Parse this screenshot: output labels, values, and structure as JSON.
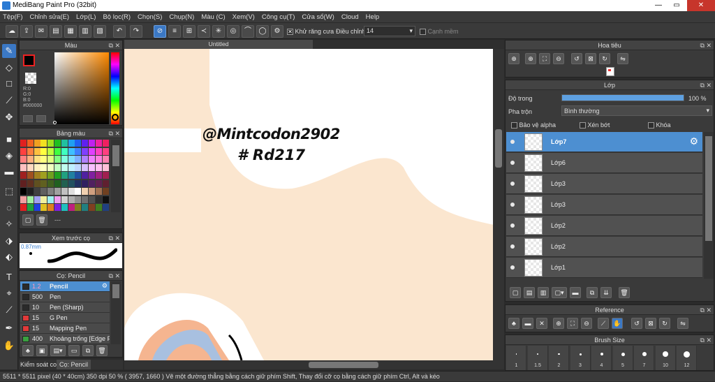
{
  "window": {
    "title": "MediBang Paint Pro (32bit)",
    "minimize": "—",
    "maximize": "▭",
    "close": "✕"
  },
  "menu": [
    "Tệp(F)",
    "Chỉnh sửa(E)",
    "Lớp(L)",
    "Bộ lọc(R)",
    "Chọn(S)",
    "Chụp(N)",
    "Màu (C)",
    "Xem(V)",
    "Công cụ(T)",
    "Cửa sổ(W)",
    "Cloud",
    "Help"
  ],
  "toolbar": {
    "antialias_label": "Khử răng cưa",
    "adjust_label": "Điều chỉnh",
    "adjust_value": "14",
    "edge_label": "Cạnh mềm"
  },
  "color_panel": {
    "title": "Màu",
    "r": "R:0",
    "g": "G:0",
    "b": "B:0",
    "hex": "#000000"
  },
  "palette_panel": {
    "title": "Bảng màu",
    "footer": "---"
  },
  "brush_preview": {
    "title": "Xem trước cọ",
    "size": "0.87mm"
  },
  "brush_panel": {
    "title": "Cọ: Pencil",
    "items": [
      {
        "size": "1.2",
        "name": "Pencil",
        "color": "#2a2a2a"
      },
      {
        "size": "500",
        "name": "Pen",
        "color": "#2a2a2a"
      },
      {
        "size": "10",
        "name": "Pen (Sharp)",
        "color": "#2a2a2a"
      },
      {
        "size": "15",
        "name": "G Pen",
        "color": "#e03a3a"
      },
      {
        "size": "15",
        "name": "Mapping Pen",
        "color": "#e03a3a"
      },
      {
        "size": "400",
        "name": "Khoảng trống [Edge P",
        "color": "#3aa040"
      }
    ]
  },
  "bottom_tabs": [
    "Kiểm soát co",
    "Cọ: Pencil"
  ],
  "canvas": {
    "tab_title": "Untitled",
    "handwriting_line1": "@Mintcodon2902",
    "handwriting_line2": "# Rd217"
  },
  "navigator_panel": {
    "title": "Hoa tiêu"
  },
  "layer_panel": {
    "title": "Lớp",
    "opacity_label": "Độ trong",
    "opacity_value": "100 %",
    "opacity_fraction": 1.0,
    "blend_label": "Pha trộn",
    "blend_value": "Bình thường",
    "protect_alpha": "Bảo vệ alpha",
    "clip": "Xén bớt",
    "lock": "Khóa",
    "layers": [
      "Lớp7",
      "Lớp6",
      "Lớp3",
      "Lớp3",
      "Lớp2",
      "Lớp2",
      "Lớp1"
    ]
  },
  "reference_panel": {
    "title": "Reference"
  },
  "brush_size_panel": {
    "title": "Brush Size",
    "sizes": [
      "1",
      "1.5",
      "2",
      "3",
      "4",
      "5",
      "7",
      "10",
      "12"
    ]
  },
  "status": "5511 * 5511 pixel  (40 * 40cm)  350 dpi  50 %  ( 3957, 1660 )  Vẽ một đường thẳng bằng cách giữ phím Shift, Thay đổi cỡ cọ bằng cách giữ phím Ctrl, Alt và kéo"
}
